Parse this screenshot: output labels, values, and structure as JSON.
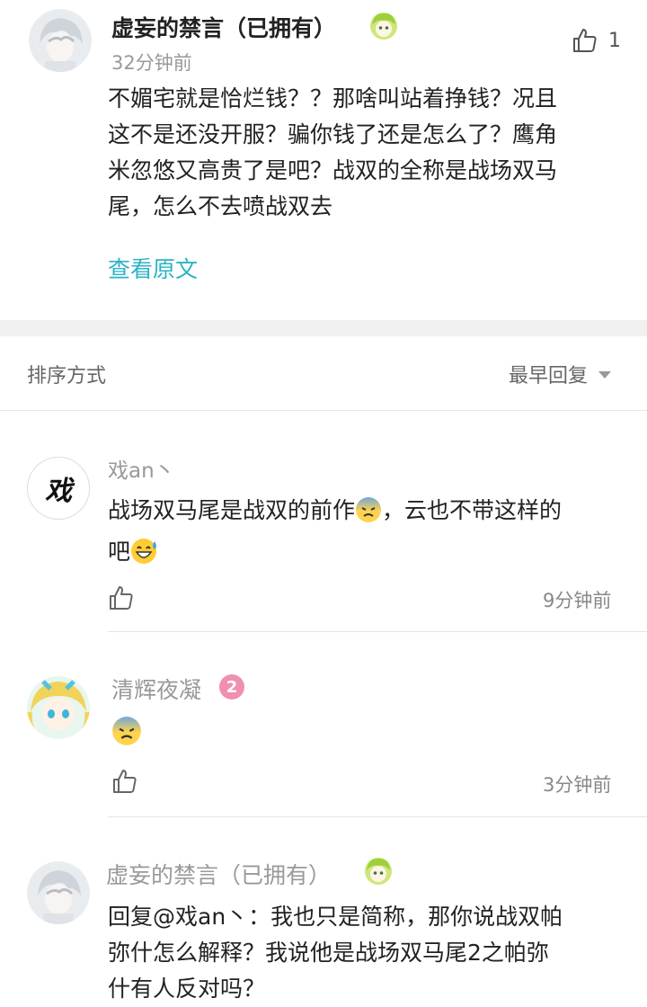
{
  "top_comment": {
    "author": "虚妄的禁言（已拥有）",
    "time": "32分钟前",
    "like_count": "1",
    "lines": [
      "不媚宅就是恰烂钱？？那啥叫站着挣钱？况且",
      "这不是还没开服？骗你钱了还是怎么了？鹰角",
      "米忽悠又高贵了是吧？战双的全称是战场双马",
      "尾，怎么不去喷战双去"
    ],
    "view_original": "查看原文"
  },
  "sort_bar": {
    "label": "排序方式",
    "option": "最早回复"
  },
  "replies": [
    {
      "author": "戏an丶",
      "avatar_char": "戏",
      "line1_a": "战场双马尾是战双的前作",
      "line1_b": "，云也不带这样的",
      "line2": "吧",
      "time": "9分钟前"
    },
    {
      "author": "清辉夜凝",
      "level": "2",
      "time": "3分钟前"
    },
    {
      "author": "虚妄的禁言（已拥有）",
      "lines": [
        "回复@戏an丶：我也只是简称，那你说战双帕",
        "弥什怎么解释？我说他是战场双马尾2之帕弥",
        "什有人反对吗？"
      ]
    }
  ],
  "colors": {
    "link": "#2bb3c6",
    "muted": "#999999",
    "badge": "#f08fb0",
    "separator": "#f0f0f0"
  }
}
